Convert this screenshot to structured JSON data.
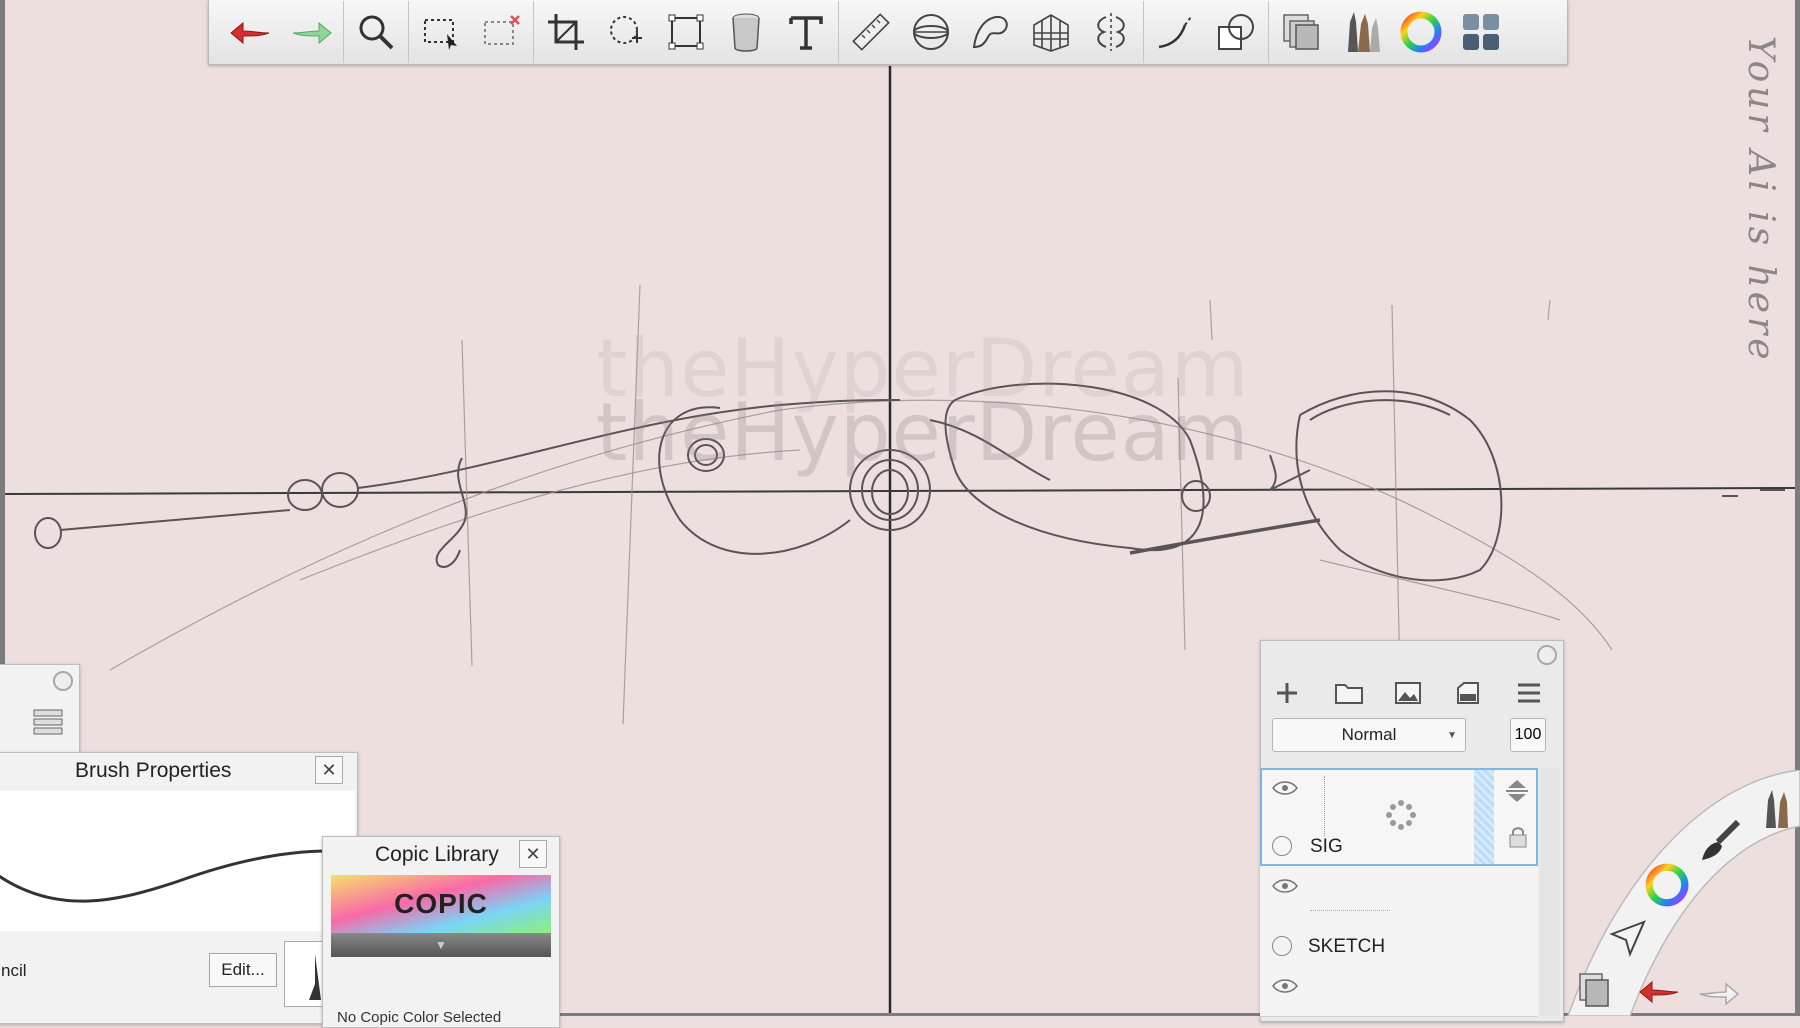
{
  "watermark": {
    "line1": "theHyperDream",
    "line2": "theHyperDream"
  },
  "signature": "Your Ai is here",
  "toolbar": {
    "buttons": [
      {
        "name": "undo-icon"
      },
      {
        "name": "redo-icon"
      },
      {
        "name": "zoom-icon"
      },
      {
        "name": "select-icon"
      },
      {
        "name": "deselect-icon"
      },
      {
        "name": "crop-icon"
      },
      {
        "name": "lasso-transform-icon"
      },
      {
        "name": "transform-icon"
      },
      {
        "name": "fill-icon"
      },
      {
        "name": "text-icon"
      },
      {
        "name": "ruler-icon"
      },
      {
        "name": "ellipse-guide-icon"
      },
      {
        "name": "french-curve-icon"
      },
      {
        "name": "perspective-icon"
      },
      {
        "name": "symmetry-icon"
      },
      {
        "name": "stroke-icon"
      },
      {
        "name": "shapes-icon"
      },
      {
        "name": "layers-icon"
      },
      {
        "name": "brushes-icon"
      },
      {
        "name": "color-wheel-icon"
      },
      {
        "name": "menu-grid-icon"
      }
    ]
  },
  "brush_properties": {
    "title": "Brush Properties",
    "brush_name": "ncil",
    "edit_label": "Edit..."
  },
  "copic_library": {
    "title": "Copic Library",
    "logo": "COPIC",
    "status": "No Copic Color Selected"
  },
  "layers": {
    "blend_mode": "Normal",
    "opacity": "100",
    "items": [
      {
        "name": "SIG"
      },
      {
        "name": "SKETCH"
      },
      {
        "name": ""
      }
    ]
  },
  "colors": {
    "canvas": "#eddfde",
    "accent_red": "#d32f2f",
    "accent_green": "#8fd49a"
  }
}
